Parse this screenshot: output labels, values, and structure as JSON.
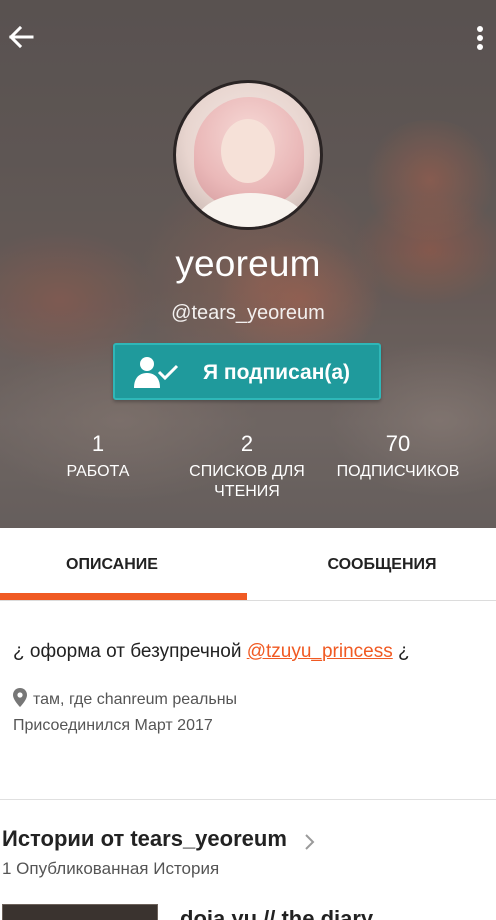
{
  "profile": {
    "display_name": "yeoreum",
    "username": "@tears_yeoreum",
    "follow_button_label": "Я подписан(а)"
  },
  "stats": [
    {
      "value": "1",
      "label": "РАБОТА"
    },
    {
      "value": "2",
      "label": "СПИСКОВ ДЛЯ ЧТЕНИЯ"
    },
    {
      "value": "70",
      "label": "ПОДПИСЧИКОВ"
    }
  ],
  "tabs": [
    {
      "label": "ОПИСАНИЕ",
      "active": true
    },
    {
      "label": "СООБЩЕНИЯ",
      "active": false
    }
  ],
  "about": {
    "desc_prefix": "¿ оформа от безупречной ",
    "desc_link": "@tzuyu_princess",
    "desc_suffix": " ¿",
    "location": "там, где chanreum реальны",
    "joined": "Присоединился Март 2017"
  },
  "stories": {
    "title": "Истории от tears_yeoreum",
    "count": "1 Опубликованная История",
    "items": [
      {
        "title": "doja yu // the diary"
      }
    ]
  },
  "icons": {
    "back": "arrow-left-icon",
    "more": "more-vert-icon",
    "follow": "person-check-icon",
    "location": "location-pin-icon",
    "chevron": "chevron-right-icon"
  },
  "colors": {
    "accent": "#f05a23",
    "follow_button": "#1f9a9c"
  }
}
